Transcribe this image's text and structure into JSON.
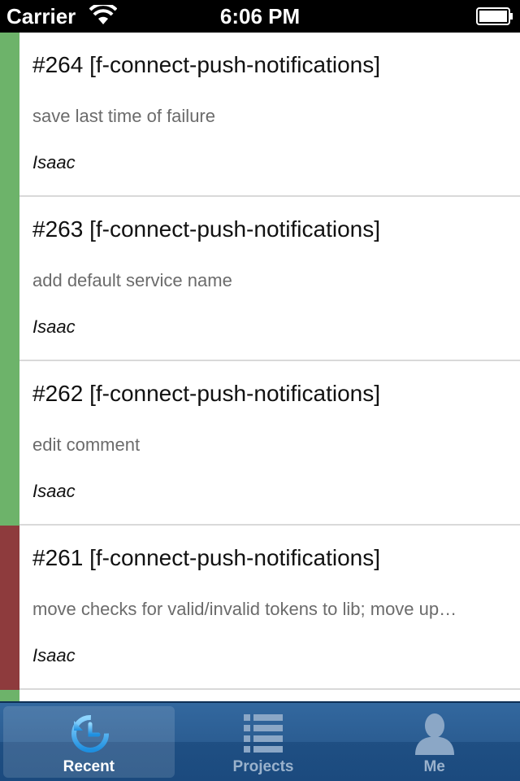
{
  "status_bar": {
    "carrier": "Carrier",
    "time": "6:06 PM"
  },
  "colors": {
    "success": "#6db36a",
    "failure": "#8e3b3d",
    "tab_bar": "#2b5d92"
  },
  "builds": [
    {
      "title": "#264 [f-connect-push-notifications]",
      "message": "save last time of failure",
      "author": "Isaac",
      "status": "success"
    },
    {
      "title": "#263 [f-connect-push-notifications]",
      "message": "add default service name",
      "author": "Isaac",
      "status": "success"
    },
    {
      "title": "#262 [f-connect-push-notifications]",
      "message": "edit comment",
      "author": "Isaac",
      "status": "success"
    },
    {
      "title": "#261 [f-connect-push-notifications]",
      "message": "move checks for valid/invalid tokens to lib; move up…",
      "author": "Isaac",
      "status": "failure"
    }
  ],
  "tab_bar": {
    "tabs": [
      {
        "label": "Recent",
        "icon": "recent-clock-icon",
        "selected": true
      },
      {
        "label": "Projects",
        "icon": "list-icon",
        "selected": false
      },
      {
        "label": "Me",
        "icon": "person-icon",
        "selected": false
      }
    ]
  }
}
